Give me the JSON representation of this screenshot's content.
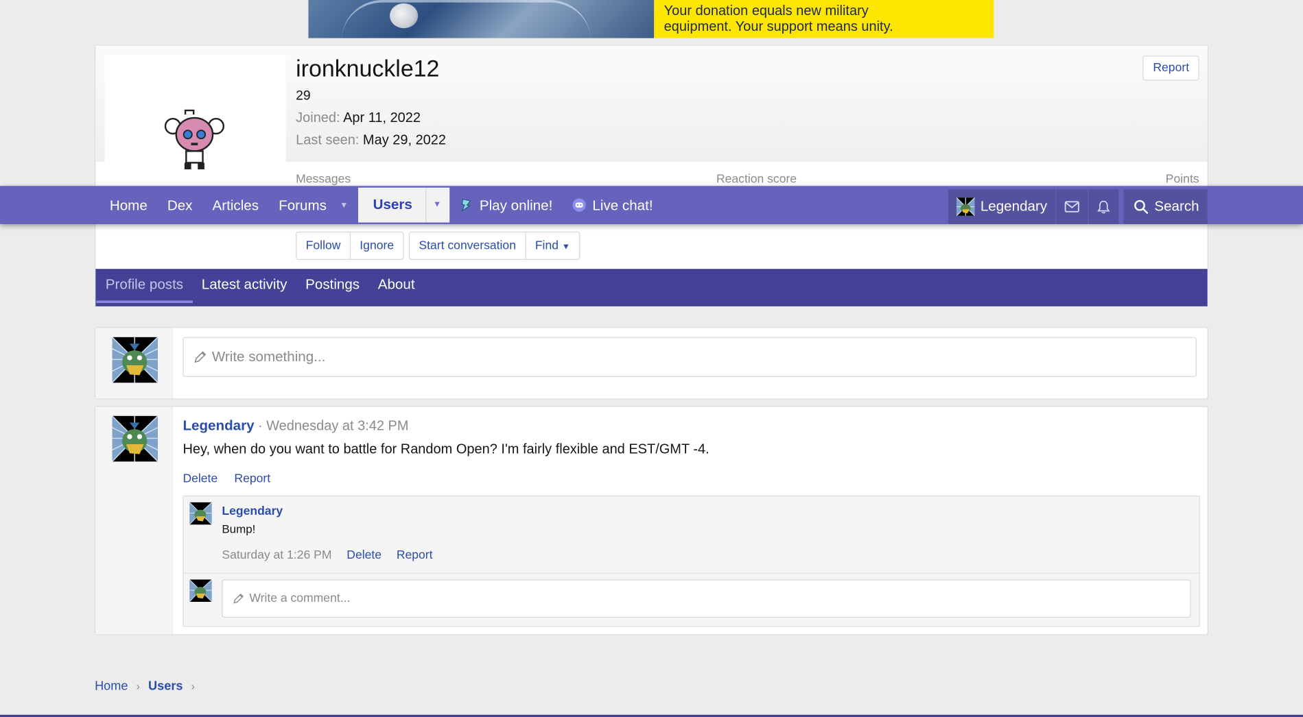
{
  "banner": {
    "line1": "Your donation equals new military",
    "line2": "equipment. Your support means unity."
  },
  "profile": {
    "username": "ironknuckle12",
    "user_title": "29",
    "joined_label": "Joined:",
    "joined_value": "Apr 11, 2022",
    "last_seen_label": "Last seen:",
    "last_seen_value": "May 29, 2022",
    "report_label": "Report",
    "stats": {
      "messages": "Messages",
      "reaction_score": "Reaction score",
      "points": "Points"
    },
    "actions": {
      "follow": "Follow",
      "ignore": "Ignore",
      "start_conversation": "Start conversation",
      "find": "Find"
    }
  },
  "nav": {
    "items": [
      "Home",
      "Dex",
      "Articles",
      "Forums",
      "Users",
      "Play online!",
      "Live chat!"
    ],
    "account": "Legendary",
    "search": "Search"
  },
  "profile_tabs": [
    "Profile posts",
    "Latest activity",
    "Postings",
    "About"
  ],
  "composer": {
    "placeholder": "Write something..."
  },
  "post": {
    "author": "Legendary",
    "time": "· Wednesday at 3:42 PM",
    "body": "Hey, when do you want to battle for Random Open? I'm fairly flexible and EST/GMT -4.",
    "delete": "Delete",
    "report": "Report",
    "comment": {
      "author": "Legendary",
      "text": "Bump!",
      "time": "Saturday at 1:26 PM",
      "delete": "Delete",
      "report": "Report"
    },
    "comment_placeholder": "Write a comment..."
  },
  "breadcrumb": [
    "Home",
    "Users"
  ],
  "colors": {
    "nav": "#6563bb",
    "tabs": "#444296",
    "link": "#2a4caa",
    "banner_yellow": "#ffe600"
  }
}
